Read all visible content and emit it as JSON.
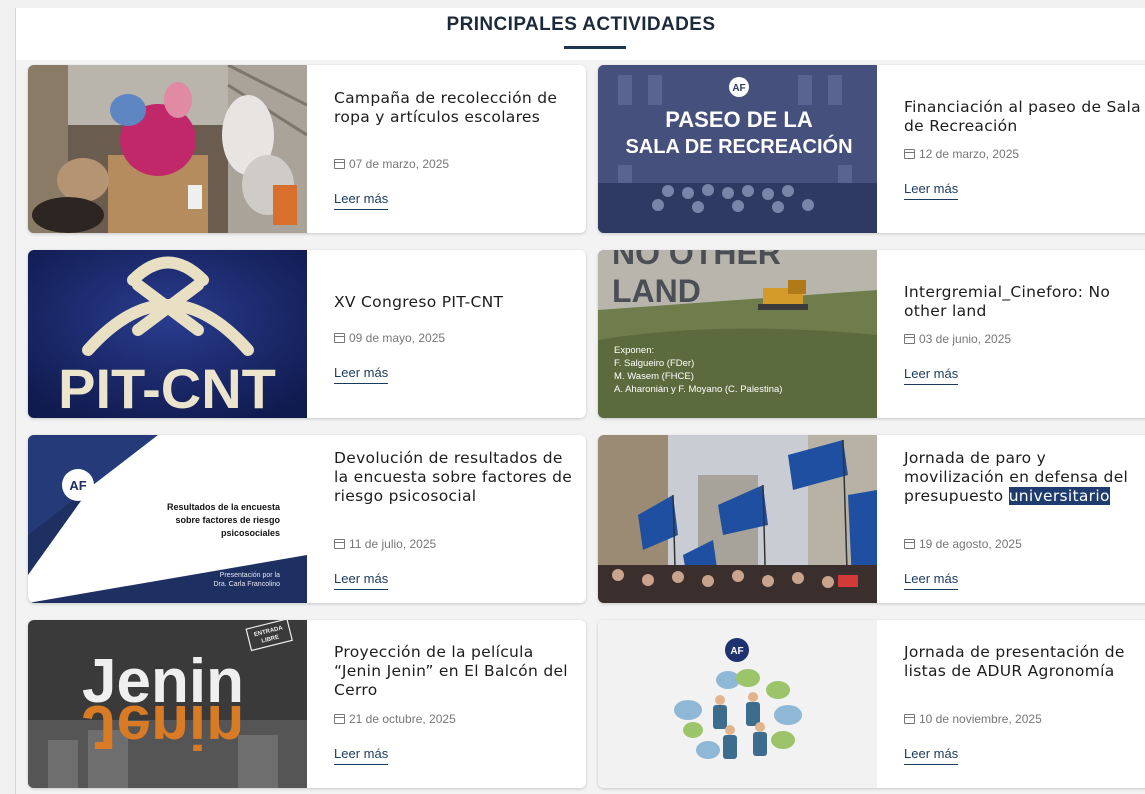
{
  "section": {
    "title": "PRINCIPALES ACTIVIDADES"
  },
  "cards": [
    {
      "title": "Campaña de recolección de ropa y artículos escolares",
      "date": "07 de marzo, 2025",
      "more": "Leer más"
    },
    {
      "title": "Financiación al paseo de Sala de Recreación",
      "date": "12 de marzo, 2025",
      "more": "Leer más",
      "image_text": {
        "line1": "PASEO DE LA",
        "line2": "SALA DE RECREACIÓN",
        "logo": "AF"
      }
    },
    {
      "title": "XV Congreso PIT-CNT",
      "date": "09 de mayo, 2025",
      "more": "Leer más",
      "image_text": {
        "logo": "PIT-CNT"
      }
    },
    {
      "title": "Intergremial_Cineforo: No other land",
      "date": "03 de junio, 2025",
      "more": "Leer más",
      "image_text": {
        "line1": "NO OTHER",
        "line2": "LAND",
        "caption": [
          "Exponen:",
          "F. Salgueiro (FDer)",
          "M. Wasem (FHCE)",
          "A. Aharonián y F. Moyano (C. Palestina)"
        ]
      }
    },
    {
      "title": "Devolución de resultados de la encuesta sobre factores de riesgo psicosocial",
      "date": "11 de julio, 2025",
      "more": "Leer más",
      "image_text": {
        "logo": "AF",
        "lines": [
          "Resultados de la encuesta",
          "sobre factores de riesgo",
          "psicosociales"
        ],
        "foot": [
          "Presentación por la",
          "Dra. Carla Francolino"
        ]
      }
    },
    {
      "title_plain": "Jornada de paro y movilización en defensa del presupuesto",
      "title_selected": "universitario",
      "date": "19 de agosto, 2025",
      "more": "Leer más"
    },
    {
      "title": "Proyección de la película “Jenin Jenin” en El Balcón del Cerro",
      "date": "21 de octubre, 2025",
      "more": "Leer más",
      "image_text": {
        "word": "Jenin",
        "ticket": [
          "ENTRADA",
          "LIBRE"
        ]
      }
    },
    {
      "title": "Jornada de presentación de listas de ADUR Agronomía",
      "date": "10 de noviembre, 2025",
      "more": "Leer más",
      "image_text": {
        "logo": "AF"
      }
    }
  ],
  "colors": {
    "accent": "#1e3552",
    "link": "#1a3a5e",
    "selection": "#1f3c6e"
  }
}
